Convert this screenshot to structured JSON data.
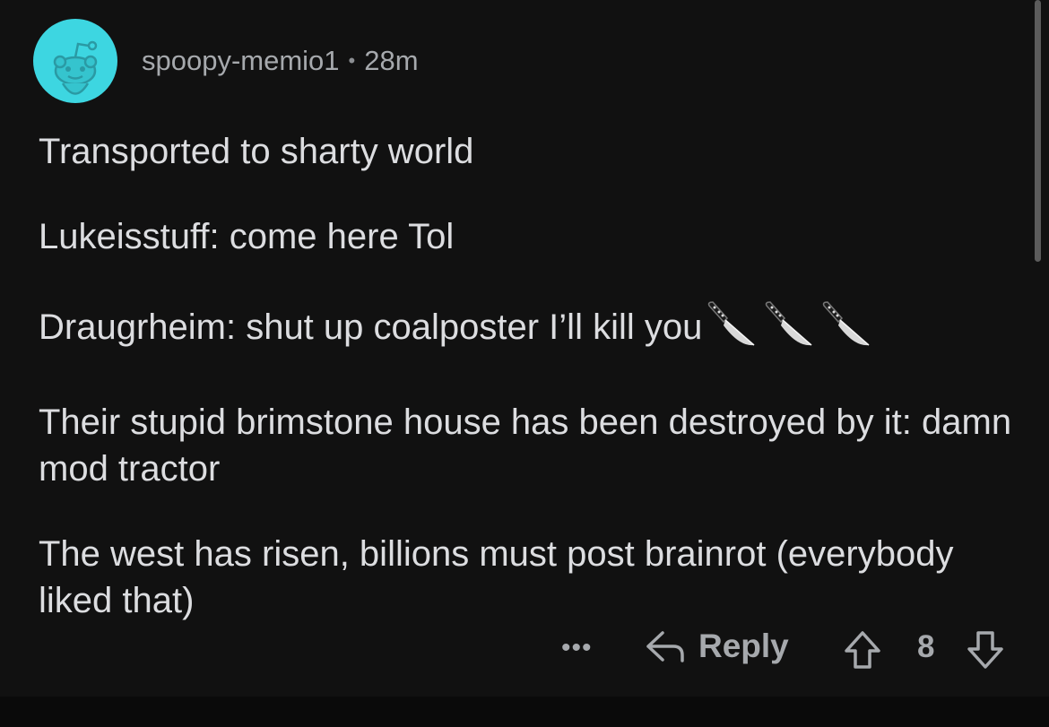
{
  "comment": {
    "author": "spoopy-memio1",
    "separator": "•",
    "age": "28m",
    "avatar_icon": "snoo-avatar-icon",
    "avatar_color": "#3dd6e1",
    "paragraphs": [
      "Transported to sharty world",
      "Lukeisstuff: come here Tol",
      "Draugrheim: shut up coalposter I’ll kill you",
      "Their stupid brimstone house has been destroyed by it: damn mod tractor",
      "The west has risen, billions must post brainrot (everybody liked that)"
    ],
    "emoji_icons": [
      "knife-icon",
      "knife-icon",
      "knife-icon"
    ]
  },
  "actions": {
    "more_label": "•••",
    "reply_label": "Reply",
    "reply_icon": "reply-arrow-icon",
    "upvote_icon": "upvote-arrow-icon",
    "score": "8",
    "downvote_icon": "downvote-arrow-icon"
  }
}
